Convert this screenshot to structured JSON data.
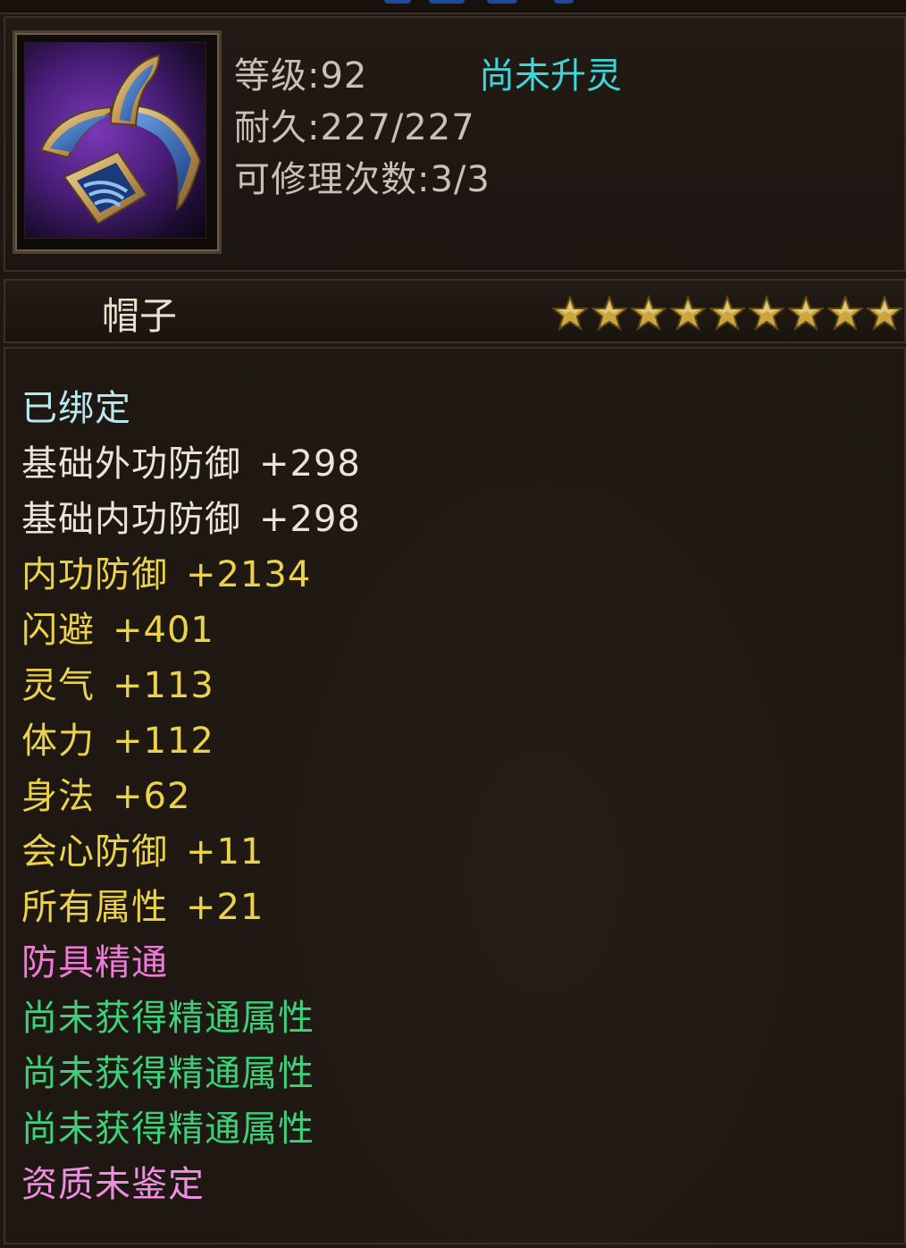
{
  "header": {
    "level_label": "等级",
    "level_value": "92",
    "durability_label": "耐久",
    "durability_value": "227/227",
    "repair_label": "可修理次数",
    "repair_value": "3/3",
    "separator": ":",
    "upgrade_status": "尚未升灵"
  },
  "item": {
    "icon": "helmet-item-icon",
    "type": "帽子",
    "star_count": 9,
    "star_color": "#c9a63e"
  },
  "attributes": {
    "bound": "已绑定",
    "base": [
      {
        "name": "基础外功防御",
        "value": "+298"
      },
      {
        "name": "基础内功防御",
        "value": "+298"
      }
    ],
    "bonus": [
      {
        "name": "内功防御",
        "value": "+2134"
      },
      {
        "name": "闪避",
        "value": "+401"
      },
      {
        "name": "灵气",
        "value": "+113"
      },
      {
        "name": "体力",
        "value": "+112"
      },
      {
        "name": "身法",
        "value": "+62"
      },
      {
        "name": "会心防御",
        "value": "+11"
      },
      {
        "name": "所有属性",
        "value": "+21"
      }
    ],
    "mastery_title": "防具精通",
    "mastery_slots": [
      "尚未获得精通属性",
      "尚未获得精通属性",
      "尚未获得精通属性"
    ],
    "aptitude": "资质未鉴定"
  },
  "colors": {
    "bound": "#b9e8ee",
    "base": "#e9e5da",
    "bonus": "#ead24a",
    "mastery": "#f07ad8",
    "unobtained": "#3dd07a",
    "upgrade_status": "#3fd6d8"
  }
}
